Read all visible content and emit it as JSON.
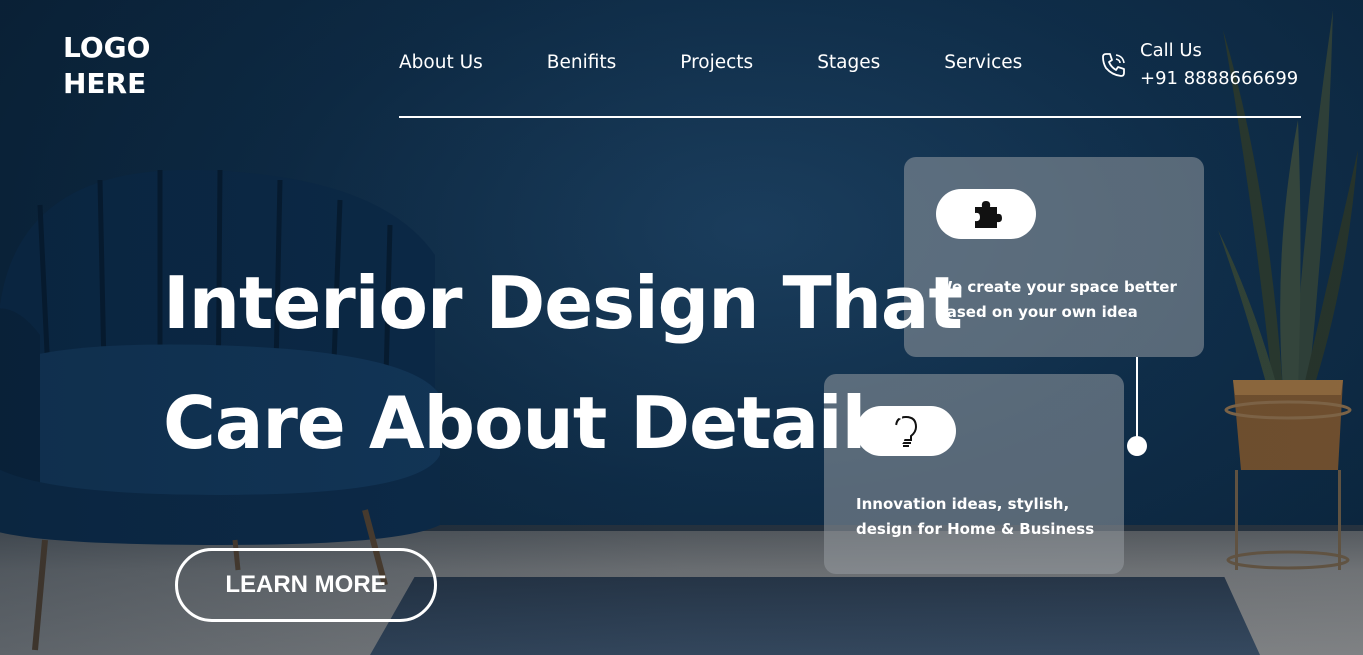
{
  "logo": {
    "line1": "LOGO",
    "line2": "HERE"
  },
  "nav": {
    "items": [
      "About Us",
      "Benifits",
      "Projects",
      "Stages",
      "Services"
    ]
  },
  "call": {
    "label": "Call Us",
    "number": "+91 8888666699",
    "icon": "phone-icon"
  },
  "hero": {
    "headline_line1": "Interior Design That",
    "headline_line2": "Care About Details",
    "cta_label": "LEARN MORE"
  },
  "cards": [
    {
      "icon": "puzzle-icon",
      "text": "We create your space better based on your own idea"
    },
    {
      "icon": "lightbulb-icon",
      "text": "Innovation ideas, stylish, design for Home & Business"
    }
  ],
  "colors": {
    "accent": "#ffffff",
    "background": "#10304d"
  }
}
